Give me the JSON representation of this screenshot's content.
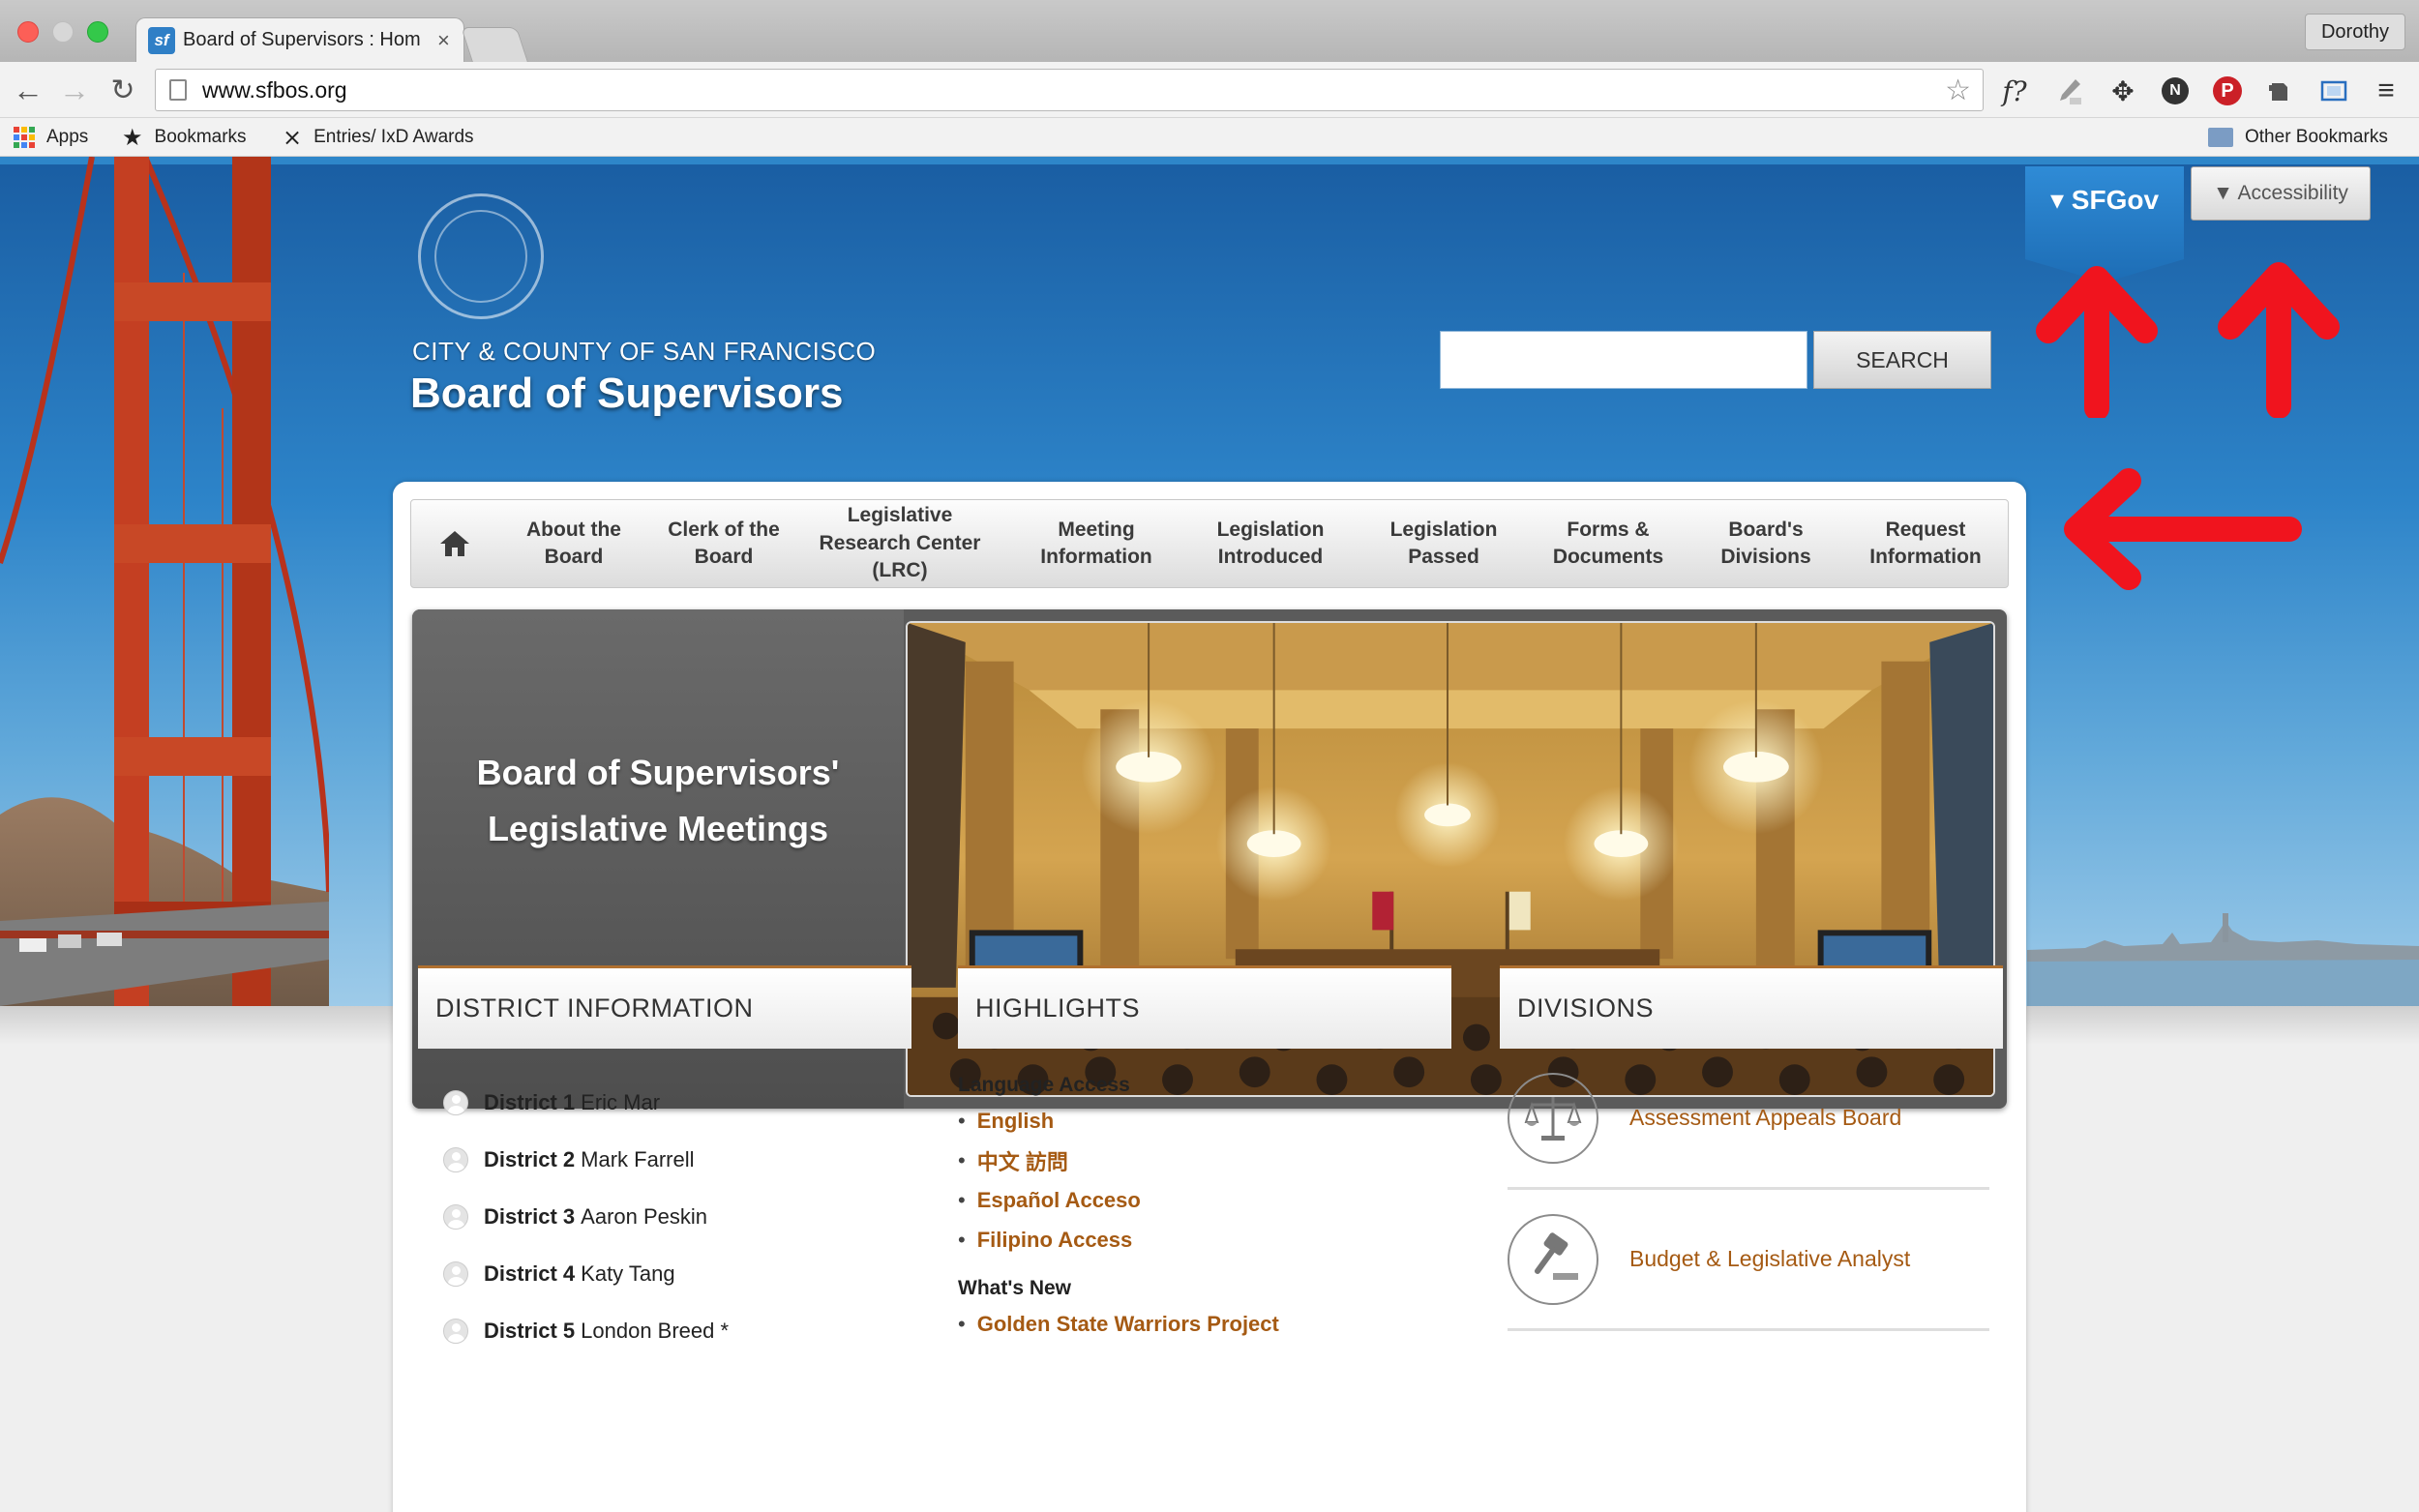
{
  "browser": {
    "tab_title": "Board of Supervisors : Hom",
    "tab_favicon": "sf",
    "tab_close": "×",
    "profile_name": "Dorothy",
    "url": "www.sfbos.org",
    "extension_f": "f?",
    "bookmarks": [
      {
        "label": "Apps",
        "icon": "apps-grid-icon"
      },
      {
        "label": "Bookmarks",
        "icon": "star-icon"
      },
      {
        "label": "Entries/ IxD Awards",
        "icon": "ixd-logo-icon"
      }
    ],
    "other_bookmarks": "Other Bookmarks"
  },
  "header": {
    "org_line": "CITY & COUNTY OF SAN FRANCISCO",
    "org_title": "Board of Supervisors",
    "search_button": "SEARCH",
    "search_value": "",
    "sfgov_label": "▾ SFGov",
    "accessibility_label": "▼ Accessibility"
  },
  "nav": {
    "items": [
      "About the Board",
      "Clerk of the Board",
      "Legislative Research Center (LRC)",
      "Meeting Information",
      "Legislation Introduced",
      "Legislation Passed",
      "Forms & Documents",
      "Board's Divisions",
      "Request Information"
    ]
  },
  "slider": {
    "heading": "Board of Supervisors' Legislative Meetings",
    "dots": 3,
    "active_dot": 1
  },
  "district": {
    "title": "DISTRICT INFORMATION",
    "items": [
      {
        "num": "District 1",
        "name": "Eric Mar"
      },
      {
        "num": "District 2",
        "name": "Mark Farrell"
      },
      {
        "num": "District 3",
        "name": "Aaron Peskin"
      },
      {
        "num": "District 4",
        "name": "Katy Tang"
      },
      {
        "num": "District 5",
        "name": "London Breed *"
      }
    ]
  },
  "highlights": {
    "title": "HIGHLIGHTS",
    "language_title": "Language Access",
    "language_links": [
      "English",
      "中文 訪問",
      "Español Acceso",
      "Filipino Access"
    ],
    "whats_new_title": "What's New",
    "whats_new_links": [
      "Golden State Warriors Project"
    ]
  },
  "divisions": {
    "title": "DIVISIONS",
    "items": [
      {
        "label": "Assessment Appeals Board",
        "icon": "scales-icon"
      },
      {
        "label": "Budget & Legislative Analyst",
        "icon": "gavel-icon"
      }
    ]
  },
  "colors": {
    "link": "#a55a13",
    "accent_rule": "#b0702f",
    "sky": "#2d84c9",
    "annotation_arrow": "#f0141e"
  }
}
